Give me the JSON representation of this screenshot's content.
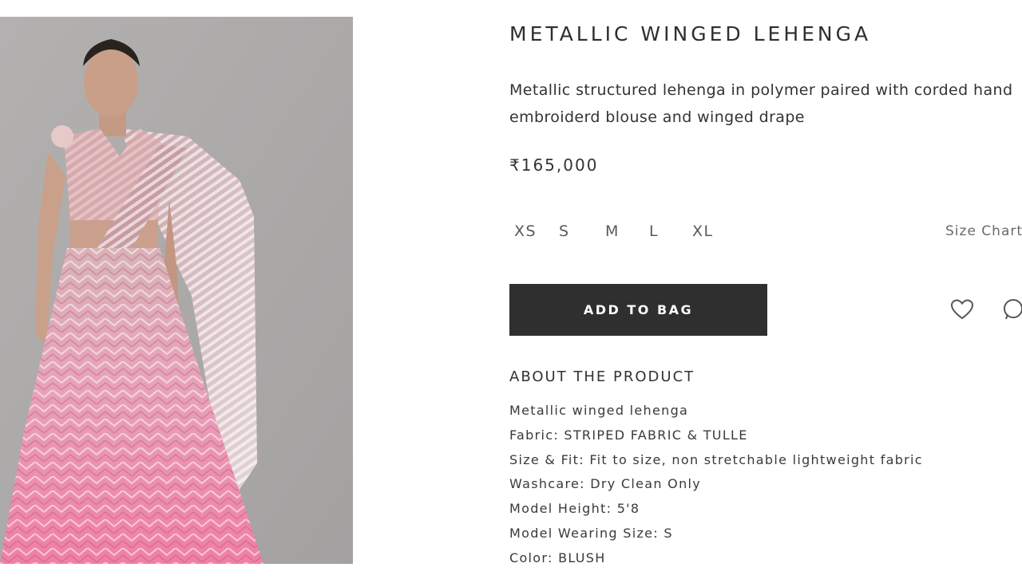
{
  "product": {
    "title": "METALLIC WINGED LEHENGA",
    "description": "Metallic structured lehenga in polymer paired with corded hand embroiderd blouse and winged drape",
    "price": "₹165,000"
  },
  "sizes": {
    "options": [
      "XS",
      "S",
      "M",
      "L",
      "XL"
    ],
    "chart_label": "Size Chart"
  },
  "actions": {
    "add_to_bag": "ADD TO BAG",
    "wishlist_icon": "heart-icon",
    "share_icon": "whatsapp-icon"
  },
  "about": {
    "heading": "ABOUT THE PRODUCT",
    "items": [
      "Metallic winged lehenga",
      "Fabric: STRIPED FABRIC & TULLE",
      "Size & Fit: Fit to size, non stretchable lightweight fabric",
      "Washcare: Dry Clean Only",
      "Model Height: 5'8",
      "Model Wearing Size: S",
      "Color: BLUSH"
    ]
  },
  "colors": {
    "button_bg": "#2f2f2f",
    "image_bg": "#a9a7a6",
    "garment_pink": "#e58aa8"
  }
}
